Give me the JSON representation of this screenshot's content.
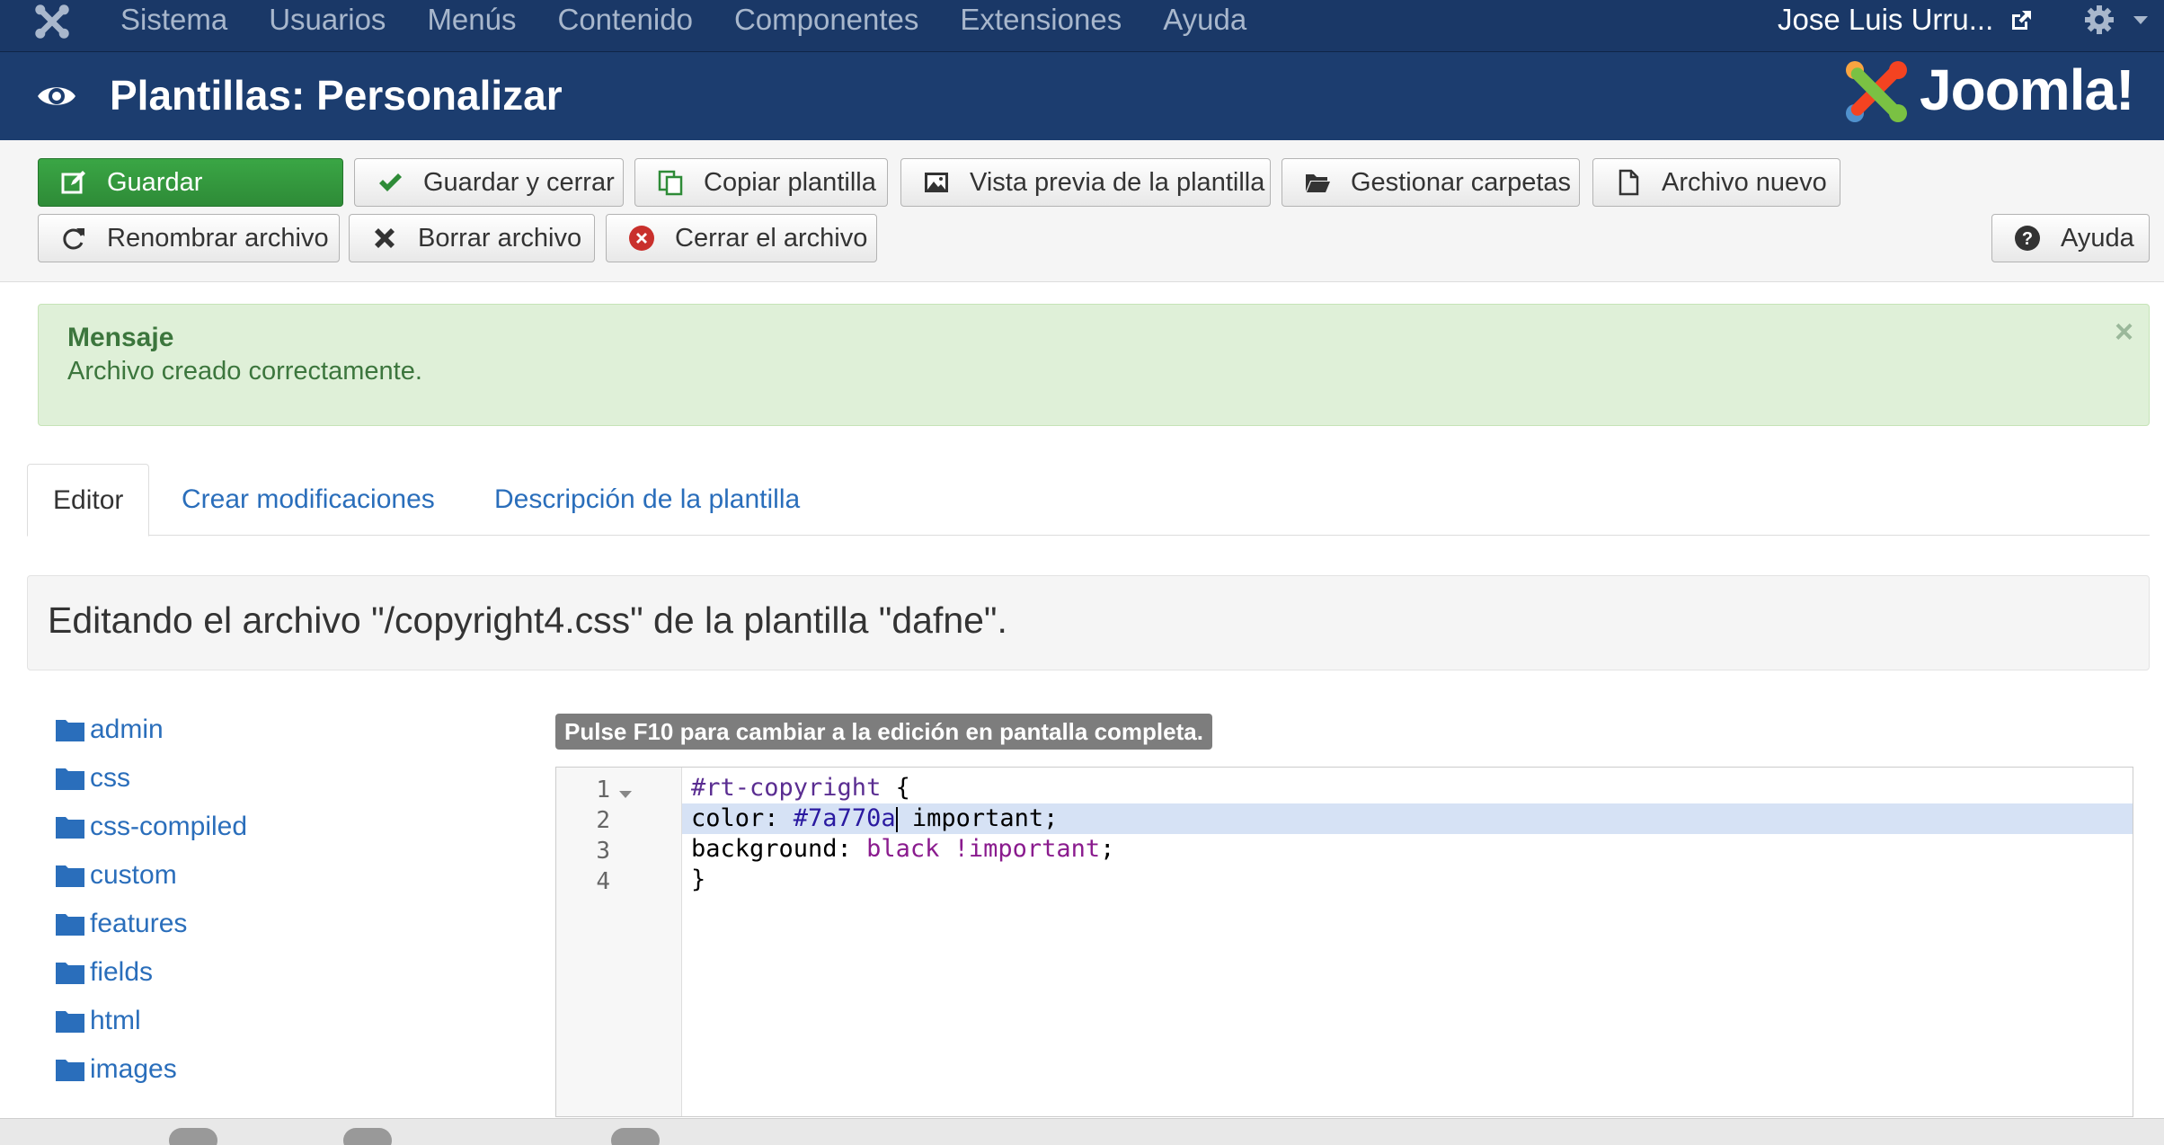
{
  "topnav": {
    "menu": [
      "Sistema",
      "Usuarios",
      "Menús",
      "Contenido",
      "Componentes",
      "Extensiones",
      "Ayuda"
    ],
    "user": "Jose Luis Urru...",
    "icons": [
      "joomla-icon",
      "external-link-icon",
      "gear-icon"
    ]
  },
  "header": {
    "title": "Plantillas: Personalizar",
    "brand": "Joomla!"
  },
  "toolbar": {
    "guardar": "Guardar",
    "guardar_cerrar": "Guardar y cerrar",
    "copiar": "Copiar plantilla",
    "vista_previa": "Vista previa de la plantilla",
    "gestionar": "Gestionar carpetas",
    "archivo_nuevo": "Archivo nuevo",
    "renombrar": "Renombrar archivo",
    "borrar": "Borrar archivo",
    "cerrar": "Cerrar el archivo",
    "ayuda": "Ayuda"
  },
  "alert": {
    "heading": "Mensaje",
    "text": "Archivo creado correctamente.",
    "close": "×"
  },
  "tabs": {
    "editor": "Editor",
    "crear": "Crear modificaciones",
    "descripcion": "Descripción de la plantilla"
  },
  "editing_text": "Editando el archivo \"/copyright4.css\" de la plantilla \"dafne\".",
  "tree": [
    "admin",
    "css",
    "css-compiled",
    "custom",
    "features",
    "fields",
    "html",
    "images"
  ],
  "editor": {
    "hint": "Pulse F10 para cambiar a la edición en pantalla completa.",
    "line_numbers": [
      "1",
      "2",
      "3",
      "4"
    ],
    "line1_selector": "#rt-copyright",
    "line1_brace": " {",
    "line2_prop": "color: ",
    "line2_value": "#7a770a",
    "line2_rest": " important;",
    "line3_prop": "background: ",
    "line3_value": "black !important",
    "line3_end": ";",
    "line4": "}"
  },
  "colors": {
    "nav_bg": "#1a3867",
    "header_bg": "#1c3d6f",
    "save_green": "#2e8b37",
    "alert_bg": "#dff0d8",
    "link": "#2a6ebb"
  }
}
